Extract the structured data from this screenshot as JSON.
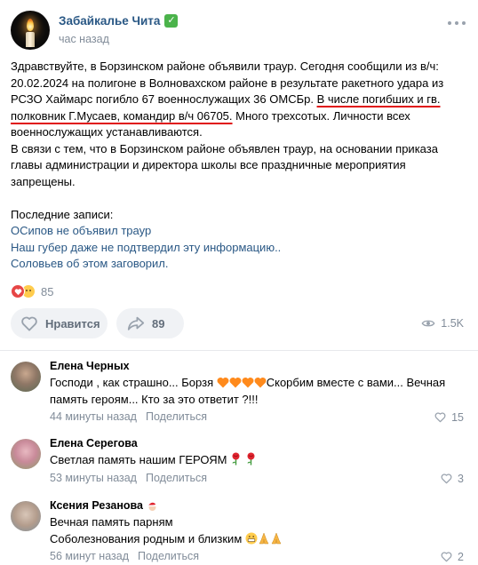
{
  "post": {
    "group_name": "Забайкалье Чита",
    "verified_icon": "check-badge-icon",
    "time": "час назад",
    "text_p1_a": "Здравствуйте, в Борзинском районе объявили траур. Сегодня сообщили из в/ч: 20.02.2024 на полигоне в Волновахском районе в результате ракетного удара из РСЗО Хаймарс погибло 67 военнослужащих 36 ОМСБр. ",
    "text_p1_underlined": "В числе погибших и гв. полковник Г.Мусаев, командир в/ч 06705.",
    "text_p1_b": " Много трехсотых. Личности всех военнослужащих устанавливаются.",
    "text_p2": "В связи с тем, что в Борзинском районе объявлен траур, на основании приказа главы администрации и директора школы все праздничные мероприятия запрещены.",
    "recent_label": "Последние записи:",
    "links": [
      "ОСипов не объявил траур",
      "Наш губер даже не подтвердил эту информацию..",
      "Соловьев об этом заговорил."
    ],
    "reactions_count": "85",
    "like_label": "Нравится",
    "share_count": "89",
    "views": "1.5K",
    "colors": {
      "link": "#2a5885",
      "underline": "#e01010",
      "muted": "#818c99"
    }
  },
  "comments": [
    {
      "author": "Елена Черных",
      "text_a": "Господи , как страшно... Борзя ",
      "text_b": "Скорбим вместе с вами... Вечная память героям... Кто за это ответит ?!!!",
      "time": "44 минуты назад",
      "share_label": "Поделиться",
      "likes": "15"
    },
    {
      "author": "Елена Серегова",
      "text_a": "Светлая память нашим ГЕРОЯМ ",
      "time": "53 минуты назад",
      "share_label": "Поделиться",
      "likes": "3"
    },
    {
      "author": "Ксения Резанова",
      "line1": "Вечная память парням",
      "line2": "Соболезнования родным и близким ",
      "time": "56 минут назад",
      "share_label": "Поделиться",
      "likes": "2"
    }
  ]
}
